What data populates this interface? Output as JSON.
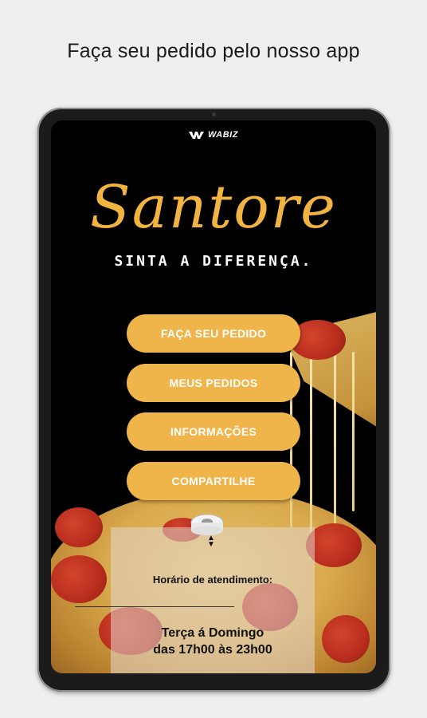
{
  "headline": "Faça seu pedido pelo nosso app",
  "provider": {
    "logo_text": "WABIZ"
  },
  "brand": {
    "name": "Santore",
    "tagline": "SINTA A DIFERENÇA."
  },
  "menu": {
    "items": [
      {
        "label": "FAÇA SEU PEDIDO"
      },
      {
        "label": "MEUS PEDIDOS"
      },
      {
        "label": "INFORMAÇÕES"
      },
      {
        "label": "COMPARTILHE"
      }
    ]
  },
  "hours": {
    "label": "Horário de atendimento:",
    "days": "Terça á Domingo",
    "time": "das 17h00 às 23h00"
  },
  "icons": {
    "wabiz": "wabiz-logo-icon",
    "roll": "paper-roll-icon",
    "arrows": "up-down-arrows-icon"
  },
  "colors": {
    "accent": "#efb44a",
    "brand": "#f2b440",
    "background": "#efefef",
    "screen": "#000000"
  }
}
